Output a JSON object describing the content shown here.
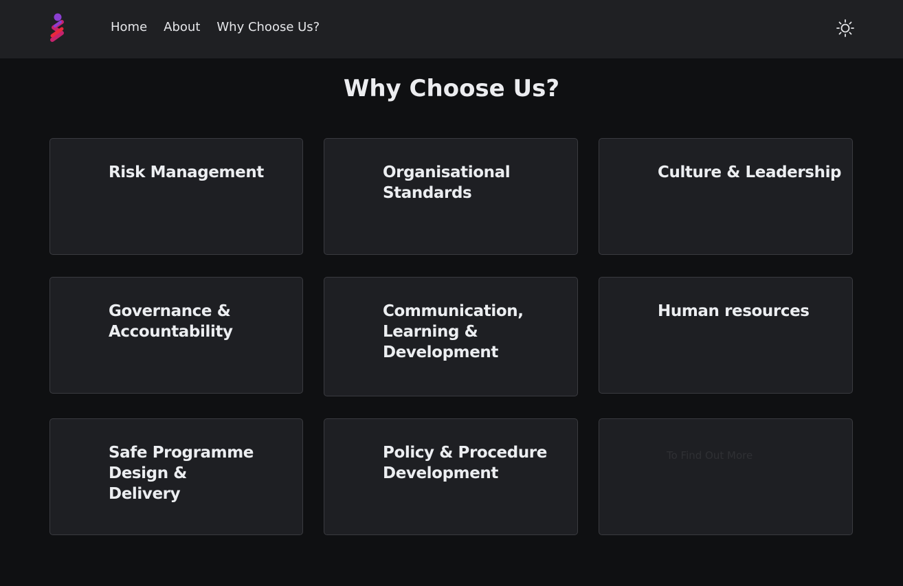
{
  "nav": {
    "links": [
      "Home",
      "About",
      "Why Choose Us?"
    ]
  },
  "page_title": "Why Choose Us?",
  "cards": [
    {
      "title": "Risk Management"
    },
    {
      "title": "Organisational Standards"
    },
    {
      "title": "Culture & Leadership"
    },
    {
      "title": "Governance & Accountability"
    },
    {
      "title": "Communication, Learning & Development"
    },
    {
      "title": "Human resources"
    },
    {
      "title": "Safe Programme Design & Delivery"
    },
    {
      "title": "Policy & Procedure Development"
    },
    {
      "title": "",
      "hint": "To Find Out More"
    }
  ],
  "colors": {
    "navbar_bg": "#1f2023",
    "page_bg": "#0f1012",
    "card_bg": "#1e1f23",
    "logo_purple": "#8b3fd1",
    "logo_red": "#e8283c"
  },
  "icons": {
    "logo": "brand-logo-icon",
    "theme": "sun-icon"
  }
}
